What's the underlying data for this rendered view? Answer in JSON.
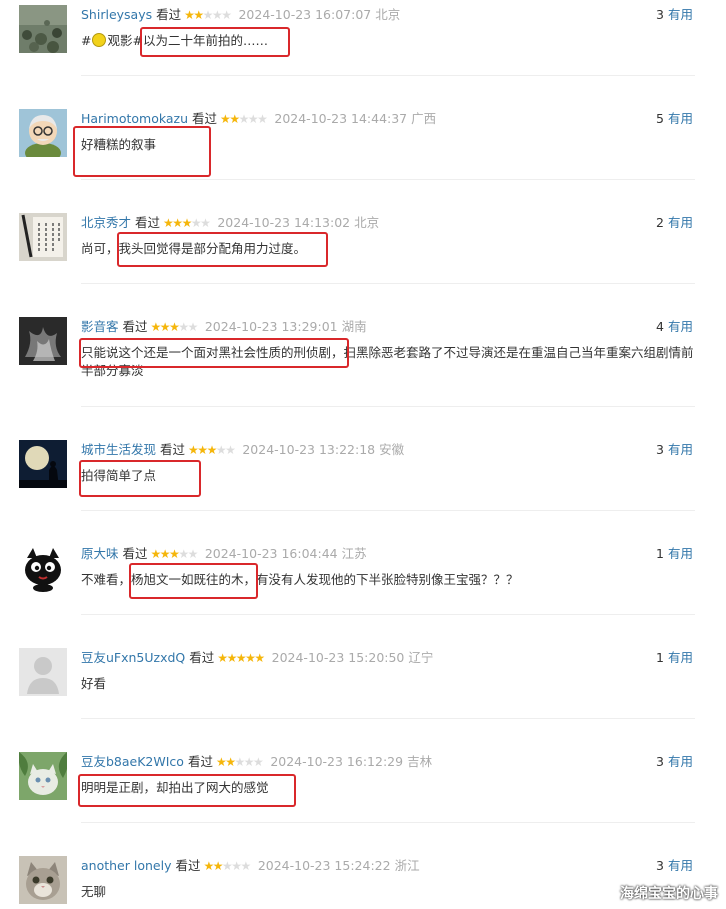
{
  "comments": [
    {
      "user": "Shirleysays",
      "status": "看过",
      "rating": 2,
      "time": "2024-10-23 16:07:07",
      "location": "北京",
      "votes": "3",
      "useful_label": "有用",
      "content_prefix": "#",
      "content_tag": "观影#",
      "content": "以为二十年前拍的……",
      "avatar": "swamp-photo"
    },
    {
      "user": "Harimotomokazu",
      "status": "看过",
      "rating": 2,
      "time": "2024-10-23 14:44:37",
      "location": "广西",
      "votes": "5",
      "useful_label": "有用",
      "content": "好糟糕的叙事",
      "avatar": "cartoon-elder"
    },
    {
      "user": "北京秀才",
      "status": "看过",
      "rating": 3,
      "time": "2024-10-23 14:13:02",
      "location": "北京",
      "votes": "2",
      "useful_label": "有用",
      "content_prefix": "尚可，",
      "content": "我头回觉得是部分配角用力过度。",
      "avatar": "calligraphy-brush"
    },
    {
      "user": "影音客",
      "status": "看过",
      "rating": 3,
      "time": "2024-10-23 13:29:01",
      "location": "湖南",
      "votes": "4",
      "useful_label": "有用",
      "content": "只能说这个还是一个面对黑社会性质的刑侦剧，扫黑除恶老套路了不过导演还是在重温自己当年重案六组剧情前半部分寡淡",
      "avatar": "smoke-art"
    },
    {
      "user": "城市生活发现",
      "status": "看过",
      "rating": 3,
      "time": "2024-10-23 13:22:18",
      "location": "安徽",
      "votes": "3",
      "useful_label": "有用",
      "content": "拍得简单了点",
      "avatar": "moon-silhouette"
    },
    {
      "user": "原大味",
      "status": "看过",
      "rating": 3,
      "time": "2024-10-23 16:04:44",
      "location": "江苏",
      "votes": "1",
      "useful_label": "有用",
      "content_prefix": "不难看，",
      "content": "杨旭文一如既往的木，",
      "content_suffix": "有没有人发现他的下半张脸特别像王宝强？？？",
      "avatar": "black-cat"
    },
    {
      "user": "豆友uFxn5UzxdQ",
      "status": "看过",
      "rating": 5,
      "time": "2024-10-23 15:20:50",
      "location": "辽宁",
      "votes": "1",
      "useful_label": "有用",
      "content": "好看",
      "avatar": "default-user"
    },
    {
      "user": "豆友b8aeK2WIco",
      "status": "看过",
      "rating": 2,
      "time": "2024-10-23 16:12:29",
      "location": "吉林",
      "votes": "3",
      "useful_label": "有用",
      "content": "明明是正剧，却拍出了网大的感觉",
      "avatar": "cat-with-leaves"
    },
    {
      "user": "another lonely",
      "status": "看过",
      "rating": 2,
      "time": "2024-10-23 15:24:22",
      "location": "浙江",
      "votes": "3",
      "useful_label": "有用",
      "content": "无聊",
      "avatar": "grey-cat"
    }
  ],
  "watermark": "海绵宝宝的心事",
  "colors": {
    "username": "#3377aa",
    "star_on": "#f5b60b",
    "star_off": "#dddddd",
    "highlight": "#d9282b",
    "meta": "#aaaaaa"
  }
}
